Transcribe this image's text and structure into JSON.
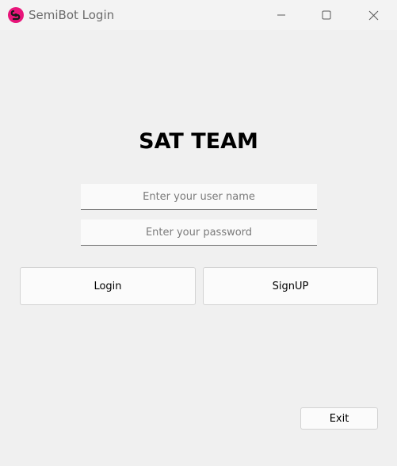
{
  "window": {
    "title": "SemiBot Login",
    "app_icon": "semibot-logo-icon",
    "controls": [
      "minimize-icon",
      "maximize-icon",
      "close-icon"
    ]
  },
  "form": {
    "heading": "SAT TEAM",
    "username_placeholder": "Enter your user name",
    "username_value": "",
    "password_placeholder": "Enter your password",
    "password_value": ""
  },
  "buttons": {
    "login_label": "Login",
    "signup_label": "SignUP",
    "exit_label": "Exit"
  },
  "colors": {
    "accent": "#e8157a",
    "background": "#f0f0f0"
  }
}
